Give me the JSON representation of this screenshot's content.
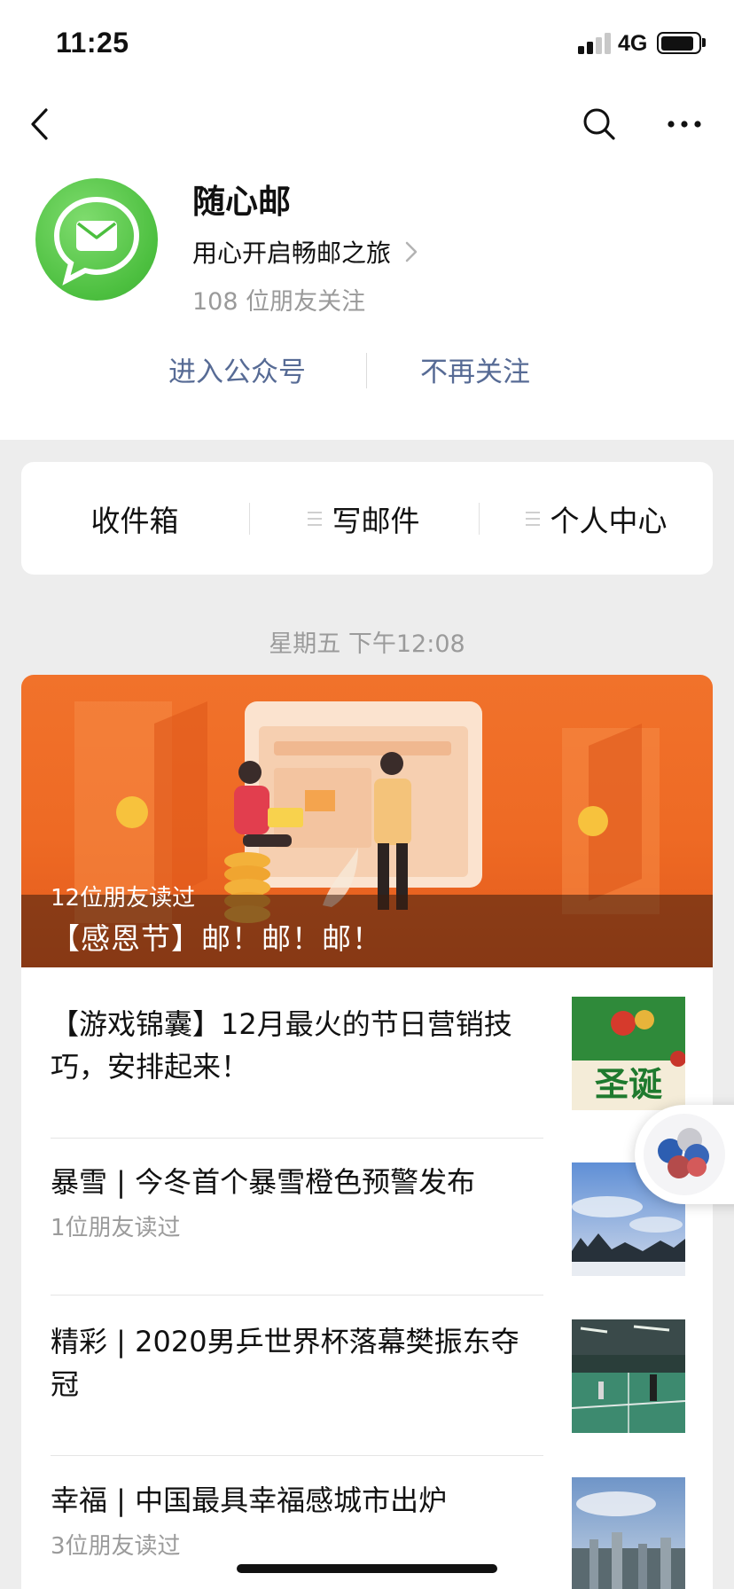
{
  "status_bar": {
    "time": "11:25",
    "network": "4G"
  },
  "profile": {
    "name": "随心邮",
    "description": "用心开启畅邮之旅",
    "followers": "108 位朋友关注",
    "enter_button": "进入公众号",
    "unfollow_button": "不再关注"
  },
  "menu": {
    "items": [
      {
        "label": "收件箱"
      },
      {
        "label": "写邮件"
      },
      {
        "label": "个人中心"
      }
    ]
  },
  "timestamp": "星期五 下午12:08",
  "articles": {
    "featured": {
      "read_count": "12位朋友读过",
      "title": "【感恩节】邮！邮！邮！"
    },
    "list": [
      {
        "title": "【游戏锦囊】12月最火的节日营销技巧，安排起来！",
        "read_count": "",
        "thumb_text": "圣诞"
      },
      {
        "title": "暴雪 | 今冬首个暴雪橙色预警发布",
        "read_count": "1位朋友读过",
        "thumb_text": ""
      },
      {
        "title": "精彩 | 2020男乒世界杯落幕樊振东夺冠",
        "read_count": "",
        "thumb_text": ""
      },
      {
        "title": "幸福 | 中国最具幸福感城市出炉",
        "read_count": "3位朋友读过",
        "thumb_text": ""
      }
    ]
  },
  "colors": {
    "link": "#576b95",
    "brand_green": "#4cbf3f",
    "banner_orange": "#ee6a24"
  }
}
